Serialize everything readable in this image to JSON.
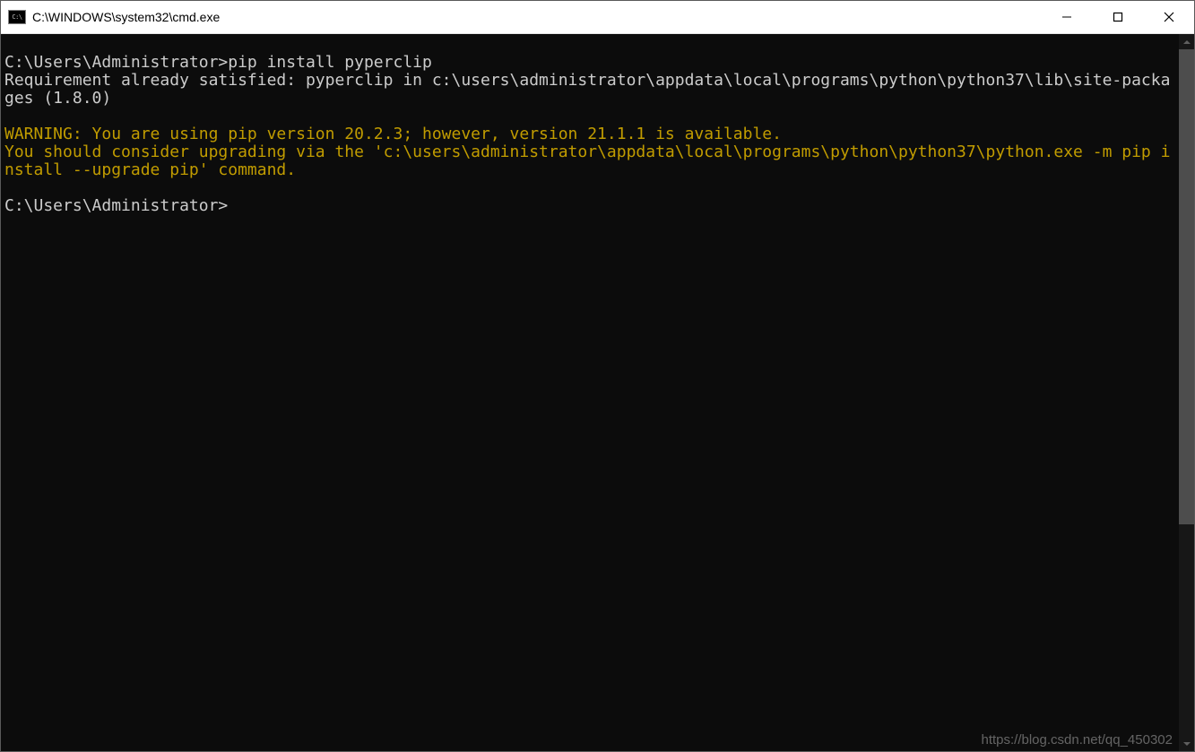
{
  "window": {
    "title": "C:\\WINDOWS\\system32\\cmd.exe"
  },
  "terminal": {
    "line1_prompt": "C:\\Users\\Administrator>",
    "line1_cmd": "pip install pyperclip",
    "line2": "Requirement already satisfied: pyperclip in c:\\users\\administrator\\appdata\\local\\programs\\python\\python37\\lib\\site-packages (1.8.0)",
    "line3_warn": "WARNING: You are using pip version 20.2.3; however, version 21.1.1 is available.",
    "line4_warn": "You should consider upgrading via the 'c:\\users\\administrator\\appdata\\local\\programs\\python\\python37\\python.exe -m pip install --upgrade pip' command.",
    "line5_prompt": "C:\\Users\\Administrator>"
  },
  "watermark": "https://blog.csdn.net/qq_450302"
}
